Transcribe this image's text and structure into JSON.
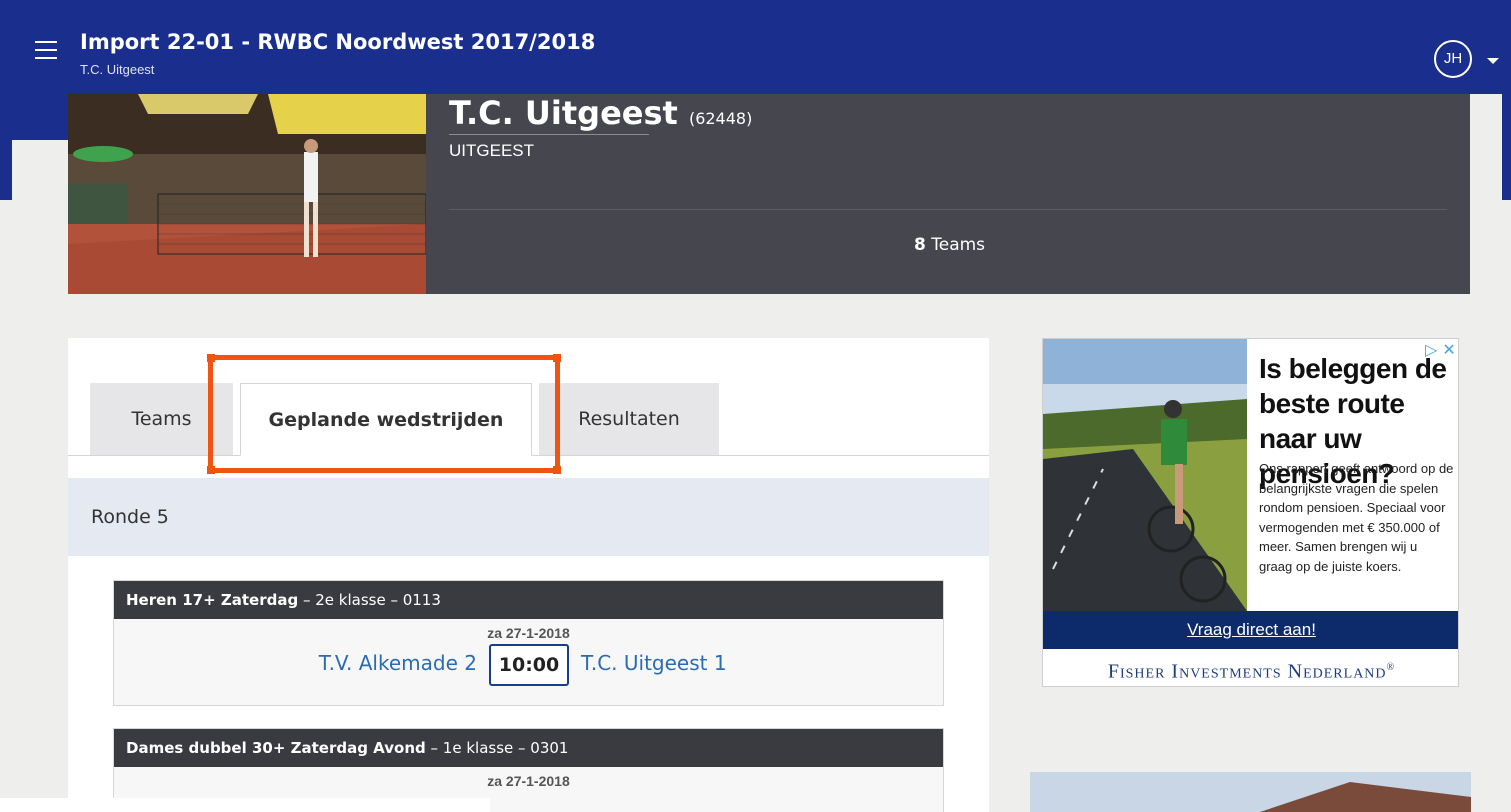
{
  "topbar": {
    "title": "Import 22-01 - RWBC Noordwest 2017/2018",
    "subtitle": "T.C. Uitgeest",
    "avatar_initials": "JH",
    "icons": {
      "menu": "hamburger-menu-icon",
      "account_caret": "chevron-down-icon"
    },
    "colors": {
      "header": "#1a2e8e"
    }
  },
  "club": {
    "name": "T.C. Uitgeest",
    "id": "(62448)",
    "city": "UITGEEST",
    "teams_count": "8",
    "teams_label": "Teams"
  },
  "tabs": [
    {
      "label": "Teams",
      "active": false
    },
    {
      "label": "Geplande wedstrijden",
      "active": true
    },
    {
      "label": "Resultaten",
      "active": false
    }
  ],
  "schedule": {
    "round": "Ronde 5",
    "matches": [
      {
        "competition": "Heren 17+ Zaterdag",
        "details": " – 2e klasse – 0113",
        "date": "za 27-1-2018",
        "home": "T.V. Alkemade 2",
        "time": "10:00",
        "away": "T.C. Uitgeest 1"
      },
      {
        "competition": "Dames dubbel 30+ Zaterdag Avond",
        "details": " – 1e klasse – 0301",
        "date": "za 27-1-2018"
      }
    ]
  },
  "ad": {
    "headline": "Is beleggen de beste route naar uw pensioen?",
    "body": "Ons rapport geeft antwoord op de belangrijkste vragen die spelen rondom pensioen. Speciaal voor vermogenden met € 350.000 of meer. Samen brengen wij u graag op de juiste koers.",
    "cta": "Vraag direct aan!",
    "brand": "Fisher Investments Nederland",
    "brand_mark": "®",
    "close": "▷ ✕"
  },
  "colors": {
    "accent_blue": "#1a2e8e",
    "link": "#2b6cb0",
    "highlight": "#f05412"
  }
}
